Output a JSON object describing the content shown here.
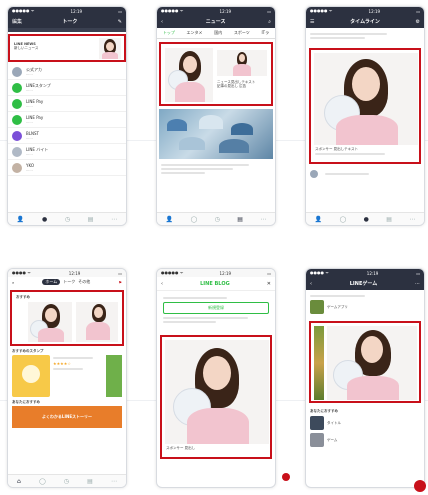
{
  "phones": {
    "p1": {
      "status": {
        "carrier": "●●●●● ᯤ",
        "time": "12:19",
        "battery": "▭"
      },
      "nav": {
        "left": "編集",
        "title": "トーク"
      },
      "banner": {
        "text1": "LINE NEWS",
        "text2": "新しいニュース"
      },
      "chats": [
        {
          "name": "公式アカ",
          "sub": "......",
          "color": "#9aa7b8"
        },
        {
          "name": "LINEスタンプ",
          "sub": "......",
          "color": "#2fbe45"
        },
        {
          "name": "LINE Pay",
          "sub": "......",
          "color": "#2fbe45"
        },
        {
          "name": "LINE Pay",
          "sub": "......",
          "color": "#2fbe45"
        },
        {
          "name": "BLNST",
          "sub": "......",
          "color": "#7b4fd8"
        },
        {
          "name": "LINE バイト",
          "sub": "......",
          "color": "#b0b9c6"
        },
        {
          "name": "YKO",
          "sub": "......",
          "color": "#c3b2a4"
        }
      ]
    },
    "p2": {
      "status": {
        "carrier": "●●●●● ᯤ",
        "time": "12:19",
        "battery": "▭"
      },
      "nav": {
        "title": "ニュース"
      },
      "tabs": [
        "トップ",
        "エンタメ",
        "国内",
        "スポーツ",
        "ITラ"
      ],
      "caption": "ニュース見出しテキスト",
      "caption2": "記事の見出し 広告"
    },
    "p3": {
      "status": {
        "carrier": "●●●●● ᯤ",
        "time": "12:19",
        "battery": "▭"
      },
      "nav": {
        "title": "タイムライン"
      },
      "caption": "スポンサー 見出しテキスト"
    },
    "p4": {
      "status": {
        "carrier": "●●●● ᯤ",
        "time": "12:19",
        "battery": "▭"
      },
      "tabs": [
        "ホーム",
        "トーク",
        "その他"
      ],
      "section1": "おすすめ",
      "section2": "おすすめのスタンプ",
      "stars": "★★★★☆",
      "section3": "あなたにおすすめ",
      "promo": "よくわかるLINEストーリー"
    },
    "p5": {
      "status": {
        "carrier": "●●●●● ᯤ",
        "time": "12:19",
        "battery": "▭"
      },
      "logo": "LINE BLOG",
      "button": "新規登録",
      "caption": "スポンサー 見出し"
    },
    "p6": {
      "status": {
        "carrier": "●●●● ᯤ",
        "time": "12:19",
        "battery": "▭"
      },
      "nav": {
        "title": "LINEゲーム"
      },
      "item1": "ゲームアプリ",
      "item2": "あなたにおすすめ",
      "item3": "タイトル",
      "item4": "ゲーム"
    }
  },
  "colors": {
    "accent": "#c8101a",
    "line_green": "#2fbe45",
    "dark_nav": "#2c3140"
  }
}
